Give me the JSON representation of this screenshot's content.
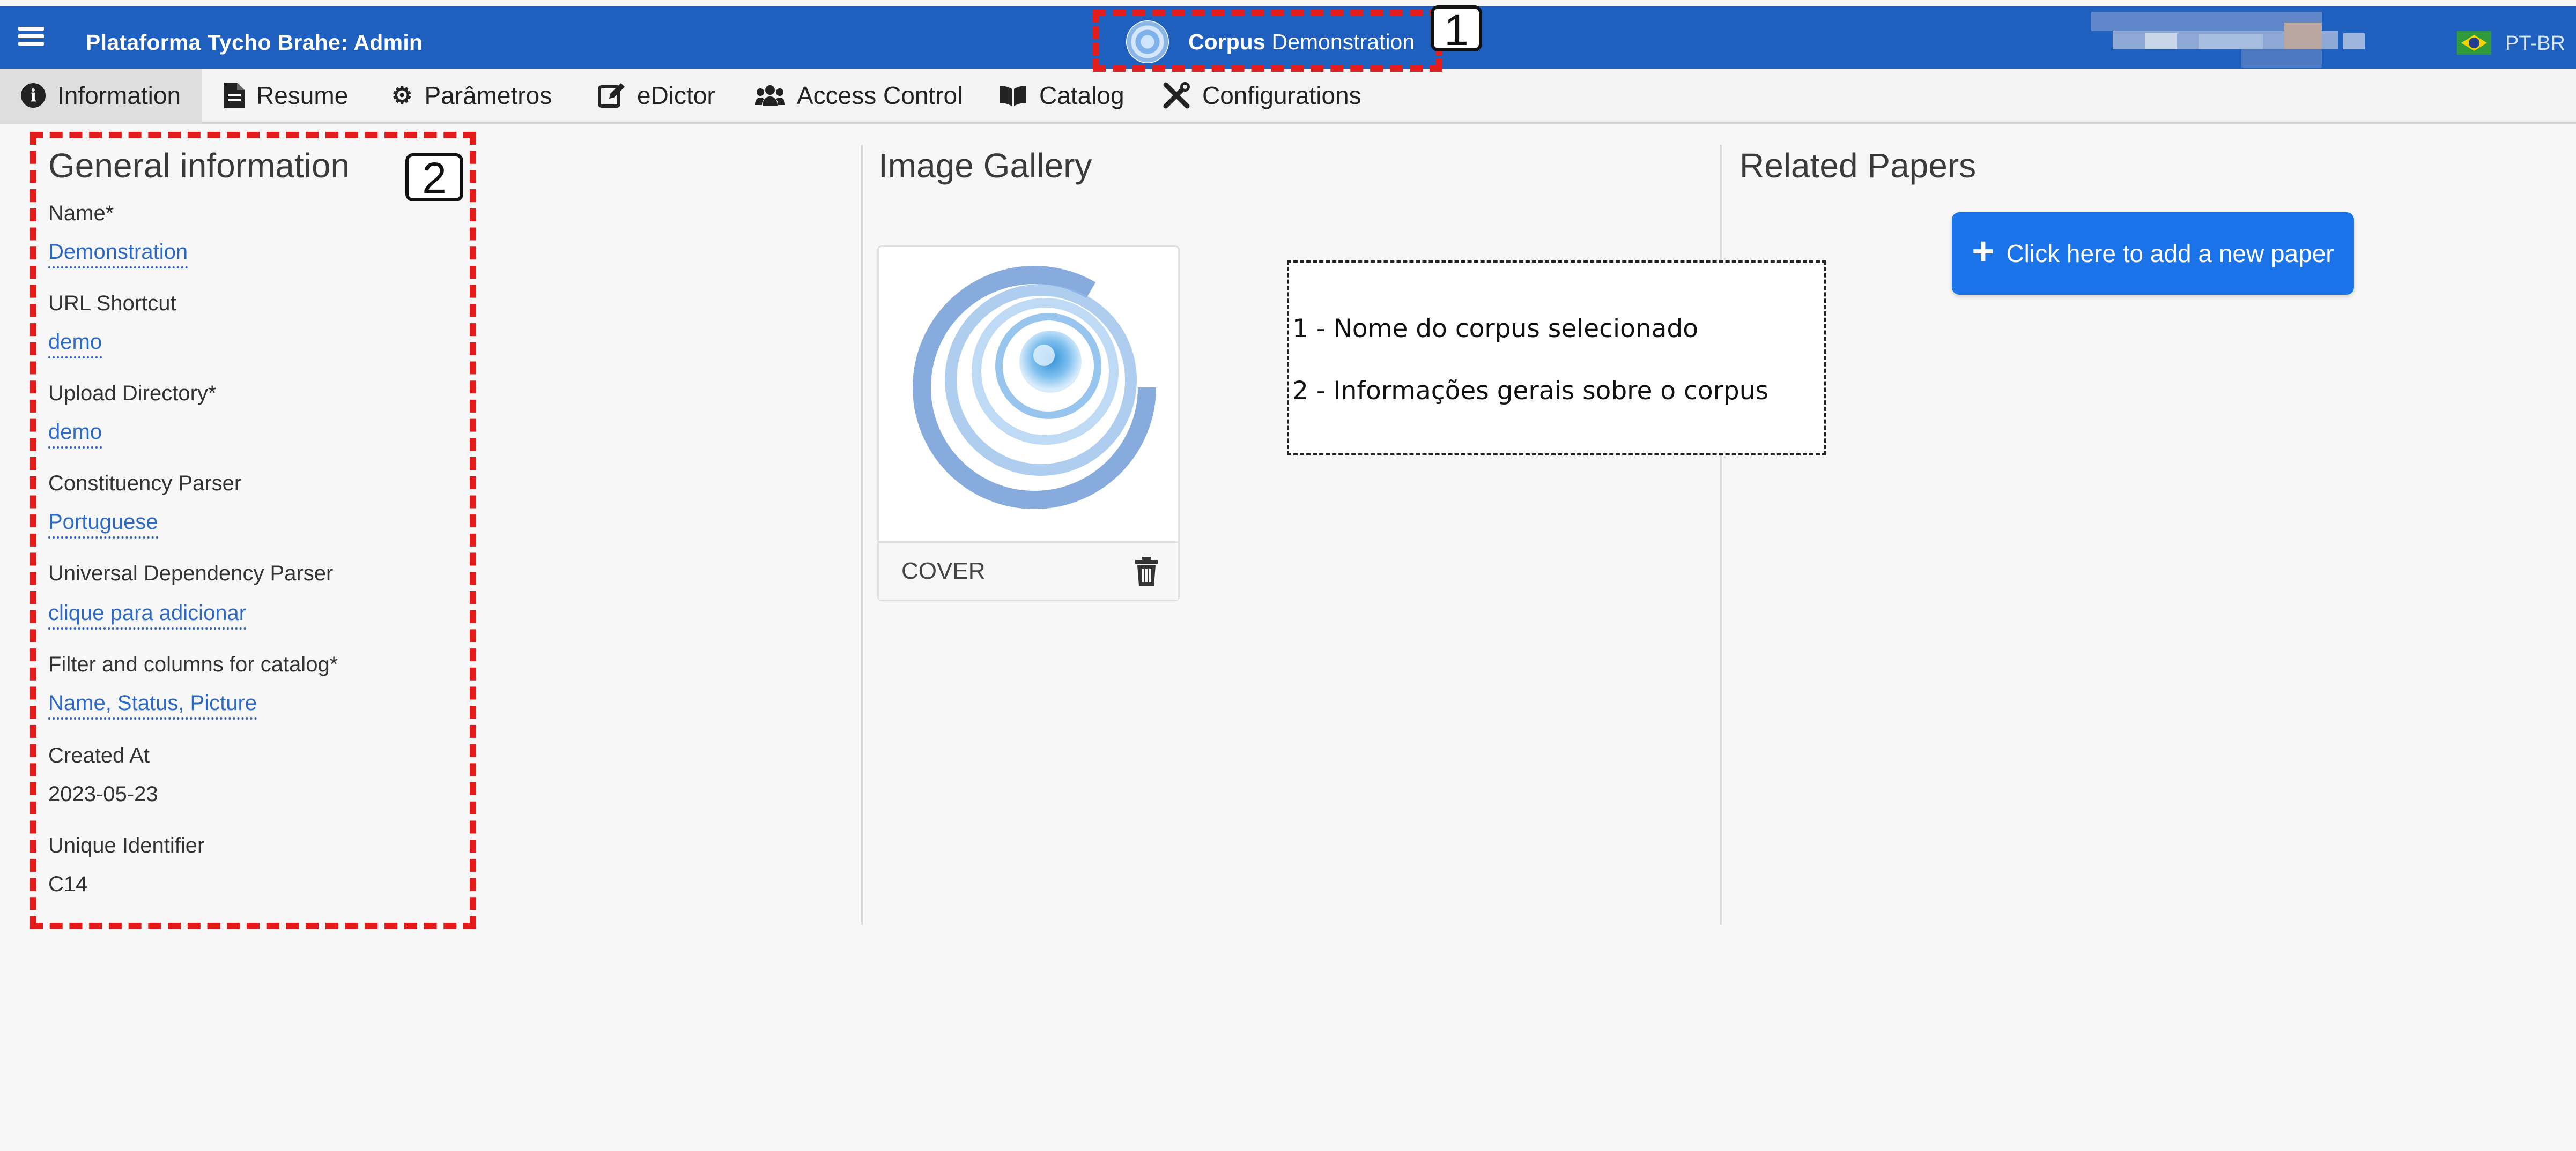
{
  "header": {
    "app_title": "Plataforma Tycho Brahe: Admin",
    "corpus_word": "Corpus",
    "corpus_name": "Demonstration",
    "language": "PT-BR",
    "bar_color": "#1f5fbe"
  },
  "tabs": [
    {
      "label": "Information",
      "icon": "info-circle-icon",
      "glyph": "i"
    },
    {
      "label": "Resume",
      "icon": "file-icon",
      "glyph": "▤"
    },
    {
      "label": "Parâmetros",
      "icon": "cogs-icon",
      "glyph": "✲"
    },
    {
      "label": "eDictor",
      "icon": "edit-icon",
      "glyph": "✎"
    },
    {
      "label": "Access Control",
      "icon": "users-icon",
      "glyph": "👥"
    },
    {
      "label": "Catalog",
      "icon": "book-open-icon",
      "glyph": "📖"
    },
    {
      "label": "Configurations",
      "icon": "tools-icon",
      "glyph": "✖"
    }
  ],
  "general": {
    "title": "General information",
    "fields": [
      {
        "label": "Name*",
        "value": "Demonstration"
      },
      {
        "label": "URL Shortcut",
        "value": "demo"
      },
      {
        "label": "Upload Directory*",
        "value": "demo"
      },
      {
        "label": "Constituency Parser",
        "value": "Portuguese"
      },
      {
        "label": "Universal Dependency Parser",
        "value": "clique para adicionar"
      },
      {
        "label": "Filter and columns for catalog*",
        "value": "Name, Status, Picture"
      },
      {
        "label": "Created At",
        "value": "2023-05-23"
      },
      {
        "label": "Unique Identifier",
        "value": "C14"
      }
    ]
  },
  "gallery": {
    "title": "Image Gallery",
    "cover_label": "COVER"
  },
  "papers": {
    "title": "Related Papers",
    "add_button": "Click here to add a new paper"
  },
  "annotations": {
    "marker_1": "1",
    "marker_2": "2",
    "note_1": "1 - Nome do corpus selecionado",
    "note_2": "2 - Informações gerais sobre o corpus",
    "highlight_color": "#e21b1b"
  }
}
